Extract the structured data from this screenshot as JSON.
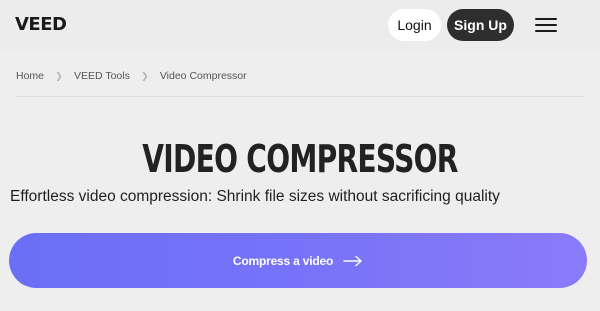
{
  "header": {
    "logo_text": "VEED",
    "login_label": "Login",
    "signup_label": "Sign Up",
    "menu_icon": "hamburger-menu-icon"
  },
  "breadcrumb": {
    "items": [
      "Home",
      "VEED Tools",
      "Video Compressor"
    ],
    "separator_icon": "chevron-right-icon"
  },
  "hero": {
    "title": "VIDEO COMPRESSOR",
    "subtitle": "Effortless video compression: Shrink file sizes without sacrificing quality",
    "cta_label": "Compress a video",
    "cta_icon": "arrow-right-icon"
  },
  "colors": {
    "background": "#eeeeee",
    "cta_start": "#6a6ff6",
    "cta_end": "#8a7bf9",
    "signup_bg": "#2e2e2e",
    "login_bg": "#ffffff"
  }
}
